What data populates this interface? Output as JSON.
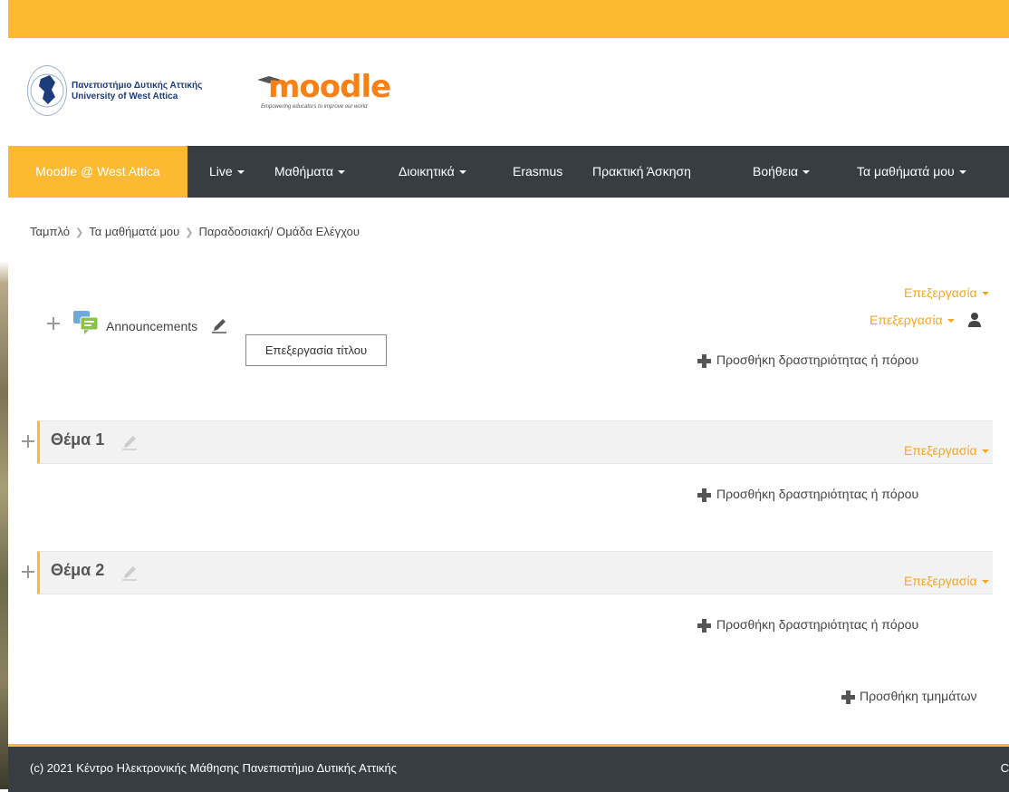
{
  "brand": {
    "university_greek": "Πανεπιστήμιο Δυτικής Αττικής",
    "university_english": "University of West Attica",
    "moodle_name": "moodle",
    "moodle_tagline": "Empowering educators to improve our world"
  },
  "navbar": {
    "brand": "Moodle @ West Attica",
    "items": [
      "Live",
      "Μαθήματα",
      "Διοικητικά",
      "Erasmus",
      "Πρακτική Άσκηση",
      "Βοήθεια",
      "Τα μαθήματά μου"
    ]
  },
  "breadcrumb": [
    "Ταμπλό",
    "Τα μαθήματά μου",
    "Παραδοσιακή/ Ομάδα Ελέγχου"
  ],
  "section0": {
    "edit": "Επεξεργασία",
    "activity_name": "Announcements",
    "activity_edit": "Επεξεργασία",
    "tooltip": "Επεξεργασία τίτλου",
    "add": "Προσθήκη δραστηριότητας ή πόρου"
  },
  "sections": [
    {
      "title": "Θέμα 1",
      "edit": "Επεξεργασία",
      "add": "Προσθήκη δραστηριότητας ή πόρου"
    },
    {
      "title": "Θέμα 2",
      "edit": "Επεξεργασία",
      "add": "Προσθήκη δραστηριότητας ή πόρου"
    }
  ],
  "add_sections": "Προσθήκη τμημάτων",
  "footer": {
    "text": "(c) 2021 Κέντρο Ηλεκτρονικής Μάθησης Πανεπιστήμιο Δυτικής Αττικής",
    "right": "C"
  },
  "colors": {
    "accent": "#fbba32",
    "navbar": "#373d43",
    "link": "#f5a623"
  }
}
